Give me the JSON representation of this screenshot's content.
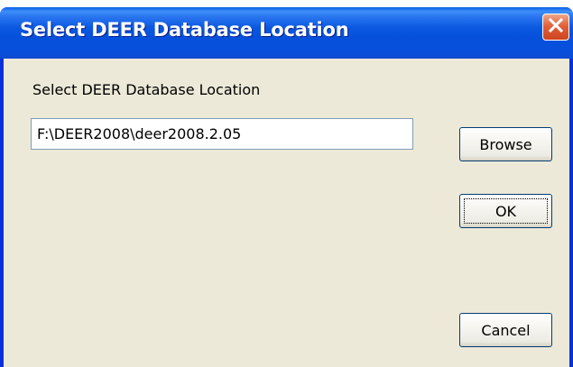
{
  "window": {
    "title": "Select DEER Database Location"
  },
  "form": {
    "label": "Select DEER Database Location",
    "path_value": "F:\\DEER2008\\deer2008.2.05"
  },
  "buttons": {
    "browse": "Browse",
    "ok": "OK",
    "cancel": "Cancel"
  },
  "icons": {
    "close": "close-icon"
  },
  "colors": {
    "titlebar": "#0a5fe6",
    "client_background": "#ece9d8",
    "close_button": "#e2623a"
  }
}
